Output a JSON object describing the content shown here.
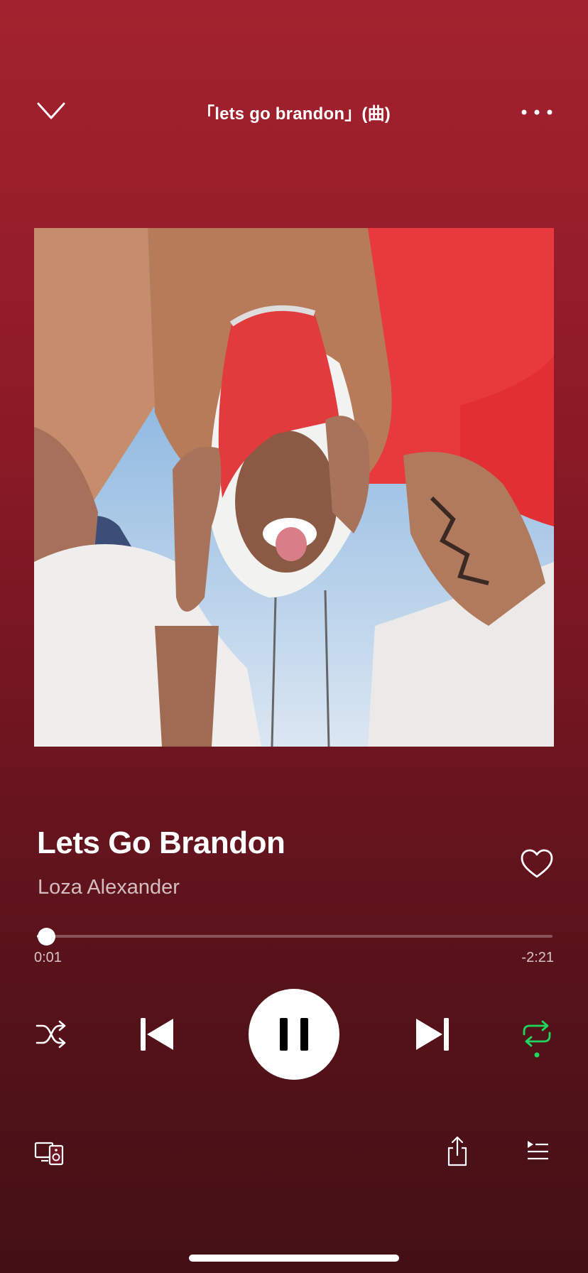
{
  "header": {
    "title": "「lets go brandon」(曲)",
    "collapse_icon": "chevron-down-icon",
    "more_icon": "more-horizontal-icon"
  },
  "artwork": {
    "icon": "album-artwork"
  },
  "track": {
    "title": "Lets Go Brandon",
    "artist": "Loza Alexander",
    "liked": false
  },
  "progress": {
    "elapsed": "0:01",
    "remaining": "-2:21",
    "fraction": 0.007
  },
  "controls": {
    "shuffle_icon": "shuffle-icon",
    "previous_icon": "skip-previous-icon",
    "play_state": "playing",
    "pause_icon": "pause-icon",
    "next_icon": "skip-next-icon",
    "repeat_icon": "repeat-icon",
    "repeat_active": true
  },
  "bottom_bar": {
    "devices_icon": "connect-devices-icon",
    "share_icon": "share-icon",
    "queue_icon": "queue-icon"
  },
  "colors": {
    "background_top": "#a3222f",
    "background_bottom": "#431016",
    "accent_green": "#1ed760",
    "foreground": "#ffffff"
  }
}
